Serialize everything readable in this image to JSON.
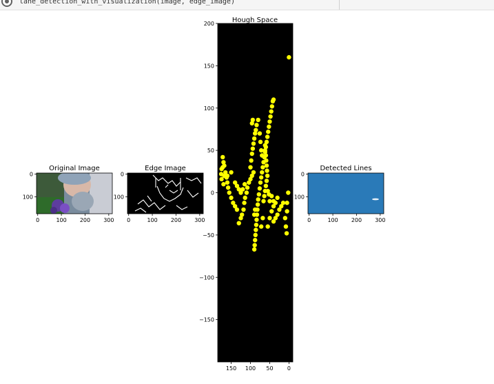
{
  "notebook": {
    "code_line": "lane_detection_with_visualization(image, edge_image)"
  },
  "panels": {
    "original": {
      "title": "Original Image",
      "xticks": [
        0,
        100,
        200,
        300
      ],
      "yticks": [
        0,
        100
      ]
    },
    "edge": {
      "title": "Edge Image",
      "xticks": [
        0,
        100,
        200,
        300
      ],
      "yticks": [
        0,
        100
      ]
    },
    "hough": {
      "title": "Hough Space",
      "xticks": [
        150,
        100,
        50,
        0
      ],
      "yticks": [
        -150,
        -100,
        -50,
        0,
        50,
        100,
        150,
        200
      ]
    },
    "detected": {
      "title": "Detected Lines",
      "xticks": [
        0,
        100,
        200,
        300
      ],
      "yticks": [
        0,
        100
      ]
    }
  },
  "chart_data": {
    "type": "scatter",
    "title": "Hough Space",
    "xlabel": "",
    "ylabel": "",
    "xlim": [
      185,
      -10
    ],
    "ylim": [
      200,
      -200
    ],
    "grid": false,
    "background": "#000000",
    "marker_color": "#ffff00",
    "series": [
      {
        "points": [
          [
            90,
            -67
          ],
          [
            89,
            -62
          ],
          [
            88,
            -56
          ],
          [
            87,
            -50
          ],
          [
            86,
            -44
          ],
          [
            85,
            -38
          ],
          [
            84,
            -32
          ],
          [
            83,
            -26
          ],
          [
            82,
            -20
          ],
          [
            81,
            -14
          ],
          [
            80,
            -8
          ],
          [
            78,
            -2
          ],
          [
            76,
            5
          ],
          [
            74,
            12
          ],
          [
            72,
            18
          ],
          [
            70,
            24
          ],
          [
            68,
            30
          ],
          [
            66,
            36
          ],
          [
            64,
            42
          ],
          [
            62,
            48
          ],
          [
            60,
            54
          ],
          [
            58,
            60
          ],
          [
            56,
            66
          ],
          [
            54,
            72
          ],
          [
            52,
            78
          ],
          [
            50,
            84
          ],
          [
            48,
            90
          ],
          [
            46,
            96
          ],
          [
            44,
            102
          ],
          [
            42,
            108
          ],
          [
            40,
            110
          ],
          [
            66,
            -10
          ],
          [
            64,
            -4
          ],
          [
            62,
            2
          ],
          [
            60,
            8
          ],
          [
            58,
            14
          ],
          [
            56,
            20
          ],
          [
            57,
            26
          ],
          [
            58,
            32
          ],
          [
            59,
            38
          ],
          [
            60,
            44
          ],
          [
            62,
            50
          ],
          [
            62,
            56
          ],
          [
            130,
            -36
          ],
          [
            125,
            -30
          ],
          [
            122,
            -26
          ],
          [
            118,
            -20
          ],
          [
            116,
            -12
          ],
          [
            114,
            -6
          ],
          [
            110,
            0
          ],
          [
            108,
            6
          ],
          [
            104,
            12
          ],
          [
            100,
            16
          ],
          [
            96,
            20
          ],
          [
            92,
            24
          ],
          [
            90,
            -26
          ],
          [
            88,
            -20
          ],
          [
            135,
            -20
          ],
          [
            140,
            -16
          ],
          [
            145,
            -12
          ],
          [
            150,
            -6
          ],
          [
            155,
            0
          ],
          [
            158,
            6
          ],
          [
            160,
            12
          ],
          [
            162,
            18
          ],
          [
            165,
            24
          ],
          [
            168,
            32
          ],
          [
            170,
            36
          ],
          [
            172,
            42
          ],
          [
            160,
            20
          ],
          [
            150,
            24
          ],
          [
            140,
            12
          ],
          [
            135,
            8
          ],
          [
            130,
            4
          ],
          [
            125,
            0
          ],
          [
            120,
            4
          ],
          [
            115,
            10
          ],
          [
            170,
            10
          ],
          [
            175,
            16
          ],
          [
            176,
            22
          ],
          [
            175,
            28
          ],
          [
            172,
            30
          ],
          [
            168,
            20
          ],
          [
            100,
            30
          ],
          [
            98,
            38
          ],
          [
            96,
            46
          ],
          [
            94,
            52
          ],
          [
            92,
            58
          ],
          [
            90,
            64
          ],
          [
            88,
            70
          ],
          [
            86,
            74
          ],
          [
            84,
            80
          ],
          [
            80,
            86
          ],
          [
            76,
            70
          ],
          [
            74,
            60
          ],
          [
            72,
            50
          ],
          [
            70,
            44
          ],
          [
            96,
            82
          ],
          [
            94,
            86
          ],
          [
            72,
            -40
          ],
          [
            68,
            -30
          ],
          [
            55,
            -40
          ],
          [
            50,
            -30
          ],
          [
            45,
            -22
          ],
          [
            40,
            -16
          ],
          [
            35,
            -12
          ],
          [
            30,
            -6
          ],
          [
            40,
            -34
          ],
          [
            35,
            -30
          ],
          [
            30,
            -26
          ],
          [
            25,
            -20
          ],
          [
            20,
            -16
          ],
          [
            15,
            -12
          ],
          [
            10,
            -30
          ],
          [
            8,
            -40
          ],
          [
            6,
            -48
          ],
          [
            5,
            -22
          ],
          [
            5,
            -12
          ],
          [
            50,
            -10
          ],
          [
            45,
            -4
          ],
          [
            40,
            -10
          ],
          [
            52,
            -2
          ],
          [
            2,
            0
          ],
          [
            55,
            2
          ],
          [
            0,
            160
          ]
        ]
      }
    ]
  }
}
